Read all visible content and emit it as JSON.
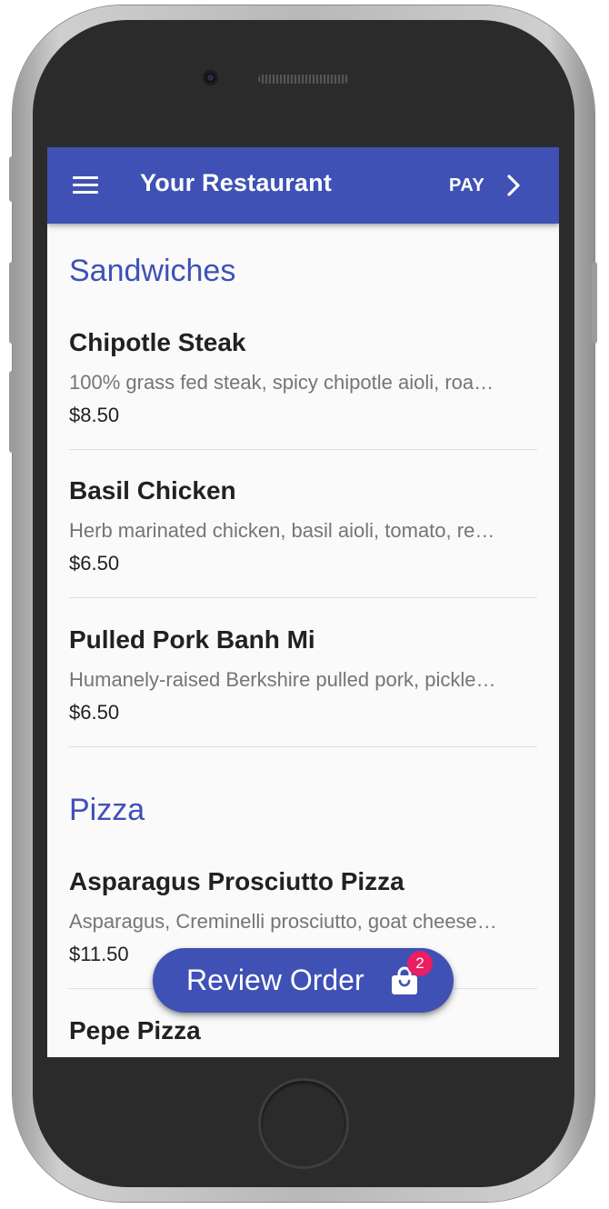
{
  "appbar": {
    "title": "Your Restaurant",
    "menu_icon": "menu-icon",
    "pay_label": "PAY",
    "pay_icon": "chevron-right-icon",
    "color": "#3f51b5"
  },
  "menu": {
    "categories": [
      {
        "name": "Sandwiches",
        "items": [
          {
            "name": "Chipotle Steak",
            "description": "100% grass fed steak, spicy chipotle aioli, roa…",
            "price": "$8.50"
          },
          {
            "name": "Basil Chicken",
            "description": "Herb marinated chicken, basil aioli, tomato, re…",
            "price": "$6.50"
          },
          {
            "name": "Pulled Pork Banh Mi",
            "description": "Humanely-raised Berkshire pulled pork, pickle…",
            "price": "$6.50"
          }
        ]
      },
      {
        "name": "Pizza",
        "items": [
          {
            "name": "Asparagus Prosciutto Pizza",
            "description": "Asparagus, Creminelli prosciutto, goat cheese…",
            "price": "$11.50"
          },
          {
            "name": "Pepe Pizza",
            "description": "",
            "price": ""
          }
        ]
      }
    ]
  },
  "fab": {
    "label": "Review Order",
    "icon": "shopping-bag-icon",
    "badge_count": "2",
    "badge_color": "#e91e63"
  }
}
